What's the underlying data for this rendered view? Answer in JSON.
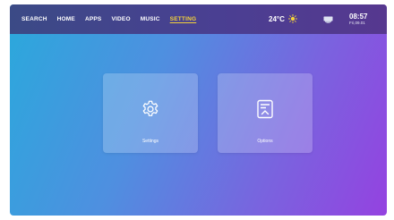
{
  "nav": {
    "items": [
      {
        "label": "SEARCH",
        "active": false
      },
      {
        "label": "HOME",
        "active": false
      },
      {
        "label": "APPS",
        "active": false
      },
      {
        "label": "VIDEO",
        "active": false
      },
      {
        "label": "MUSIC",
        "active": false
      },
      {
        "label": "SETTING",
        "active": true
      }
    ]
  },
  "status": {
    "temperature": "24°C",
    "weather_icon": "sun-icon",
    "network_icon": "wifi-icon",
    "time": "08:57",
    "date": "Fri,09.01"
  },
  "tiles": [
    {
      "label": "Settings",
      "icon": "gear-icon"
    },
    {
      "label": "Options",
      "icon": "options-icon"
    }
  ],
  "colors": {
    "active_tab": "#f4d23a",
    "sun": "#f4d23a",
    "gradient_start": "#2aa9dc",
    "gradient_end": "#9442e0"
  }
}
